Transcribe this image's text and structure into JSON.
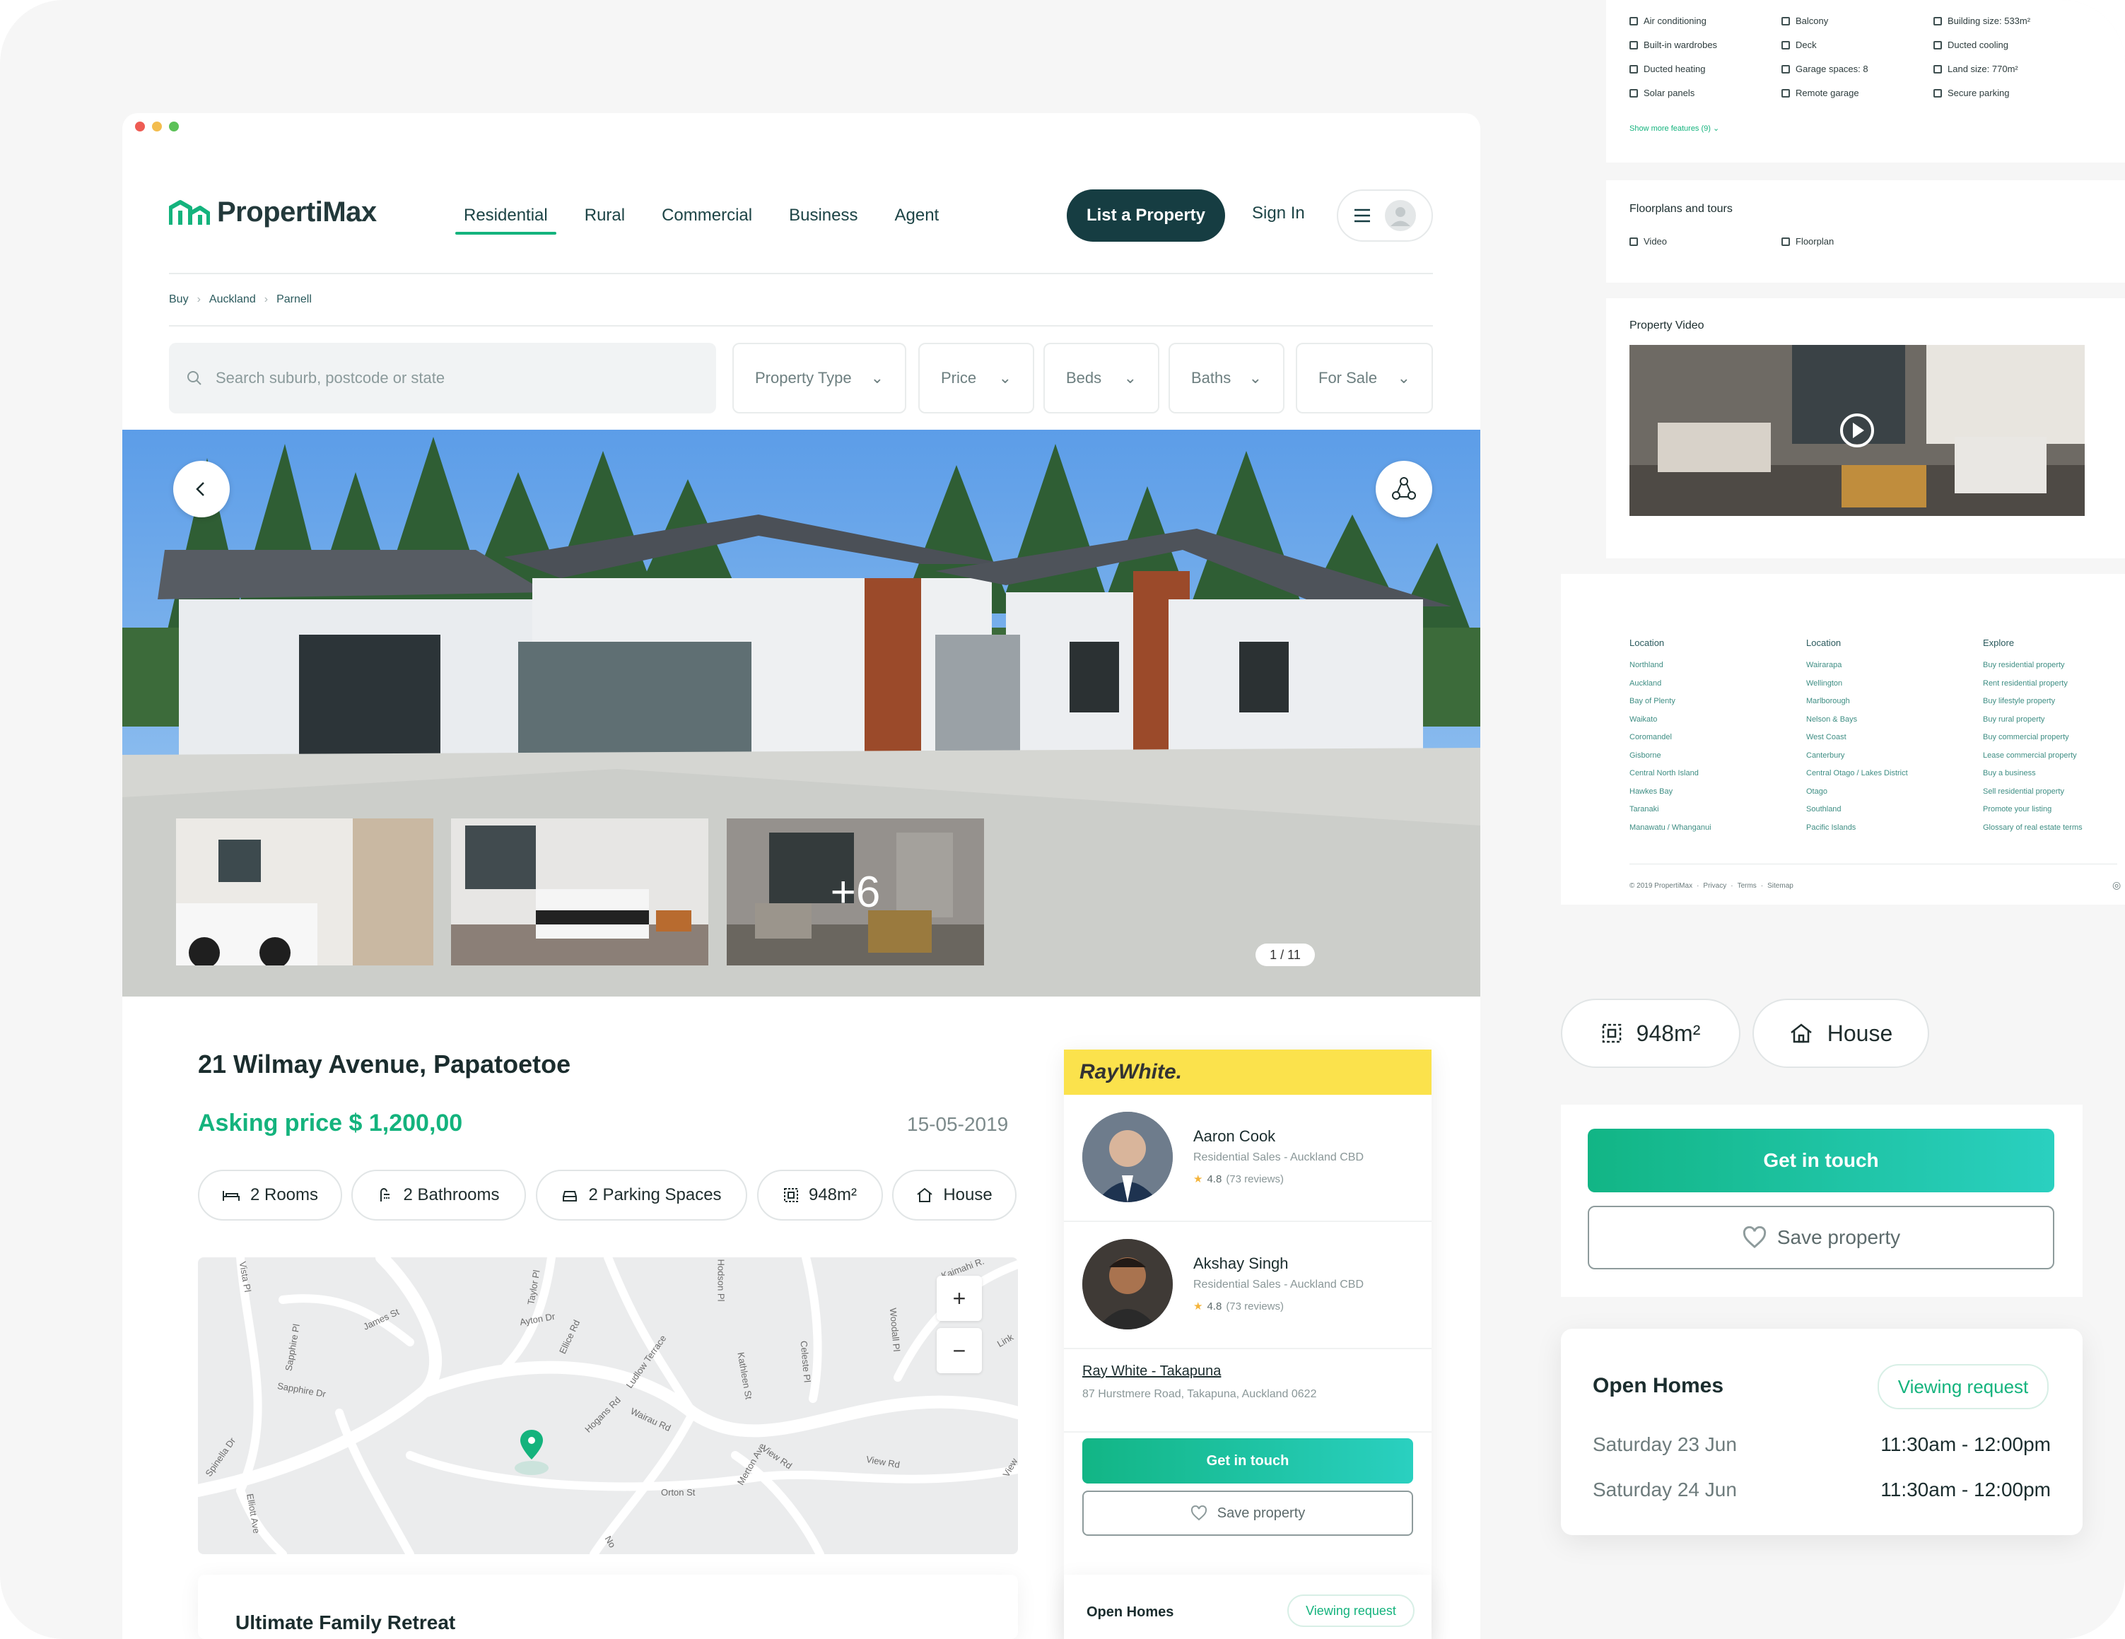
{
  "brand": {
    "name": "PropertiMax"
  },
  "nav": {
    "items": [
      "Residential",
      "Rural",
      "Commercial",
      "Business",
      "Agent"
    ],
    "active": "Residential"
  },
  "header": {
    "list_property": "List a Property",
    "sign_in": "Sign In"
  },
  "breadcrumb": [
    "Buy",
    "Auckland",
    "Parnell"
  ],
  "search": {
    "placeholder": "Search suburb, postcode or state"
  },
  "filters": [
    "Property Type",
    "Price",
    "Beds",
    "Baths",
    "For Sale"
  ],
  "gallery": {
    "more_count": "+6",
    "counter": "1 / 11"
  },
  "listing": {
    "title": "21 Wilmay Avenue, Papatoetoe",
    "price": "Asking price $ 1,200,00",
    "date": "15-05-2019",
    "chips": [
      "2 Rooms",
      "2 Bathrooms",
      "2 Parking Spaces",
      "948m²",
      "House"
    ],
    "description_title": "Ultimate Family Retreat"
  },
  "map": {
    "zoom_in": "+",
    "zoom_out": "−",
    "streets": [
      "Vista Pl",
      "James St",
      "Taylor Pl",
      "Ayton Dr",
      "Ellice Rd",
      "Ludlow Terrace",
      "Hodson Pl",
      "Kaimahi R.",
      "Sapphire Pl",
      "Sapphire Dr",
      "Kathleen St",
      "Celeste Pl",
      "Woodall Pl",
      "Link",
      "Wairau Rd",
      "Hogans Rd",
      "Merton Ave",
      "View Rd",
      "View Rd",
      "Spinella Dr",
      "Orton St",
      "Elliott Ave",
      "View",
      "No"
    ]
  },
  "agency": {
    "name": "RayWhite.",
    "agents": [
      {
        "name": "Aaron Cook",
        "role": "Residential Sales - Auckland CBD",
        "rating": "4.8",
        "reviews": "(73 reviews)"
      },
      {
        "name": "Akshay Singh",
        "role": "Residential Sales - Auckland CBD",
        "rating": "4.8",
        "reviews": "(73 reviews)"
      }
    ],
    "office_name": "Ray White - Takapuna",
    "office_address": "87 Hurstmere Road, Takapuna, Auckland 0622",
    "get_in_touch": "Get in touch",
    "save_property": "Save property"
  },
  "open_homes": {
    "title": "Open Homes",
    "viewing_request": "Viewing request",
    "slots": [
      {
        "day": "Saturday 23 Jun",
        "time": "11:30am - 12:00pm"
      },
      {
        "day": "Saturday 24 Jun",
        "time": "11:30am - 12:00pm"
      }
    ]
  },
  "features": {
    "items": [
      "Air conditioning",
      "Balcony",
      "Building size: 533m²",
      "Built-in wardrobes",
      "Deck",
      "Ducted cooling",
      "Ducted heating",
      "Garage spaces: 8",
      "Land size: 770m²",
      "Solar panels",
      "Remote garage",
      "Secure parking"
    ],
    "show_more": "Show more features (9)"
  },
  "floorplans": {
    "title": "Floorplans and tours",
    "items": [
      "Video",
      "Floorplan"
    ]
  },
  "property_video": {
    "title": "Property Video"
  },
  "footer": {
    "columns": [
      {
        "heading": "Location",
        "links": [
          "Northland",
          "Auckland",
          "Bay of Plenty",
          "Waikato",
          "Coromandel",
          "Gisborne",
          "Central North Island",
          "Hawkes Bay",
          "Taranaki",
          "Manawatu / Whanganui"
        ]
      },
      {
        "heading": "Location",
        "links": [
          "Wairarapa",
          "Wellington",
          "Marlborough",
          "Nelson & Bays",
          "West Coast",
          "Canterbury",
          "Central Otago / Lakes District",
          "Otago",
          "Southland",
          "Pacific Islands"
        ]
      },
      {
        "heading": "Explore",
        "links": [
          "Buy residential property",
          "Rent residential property",
          "Buy lifestyle property",
          "Buy rural property",
          "Buy commercial property",
          "Lease commercial property",
          "Buy a business",
          "Sell residential property",
          "Promote your listing",
          "Glossary of real estate terms"
        ]
      }
    ],
    "copyright": "© 2019 PropertiMax",
    "links": [
      "Privacy",
      "Terms",
      "Sitemap"
    ]
  },
  "side_summary": {
    "chips": [
      "948m²",
      "House"
    ]
  },
  "colors": {
    "brand_green": "#14b37d",
    "dark_teal": "#163d42",
    "agency_yellow": "#fbe24c"
  }
}
